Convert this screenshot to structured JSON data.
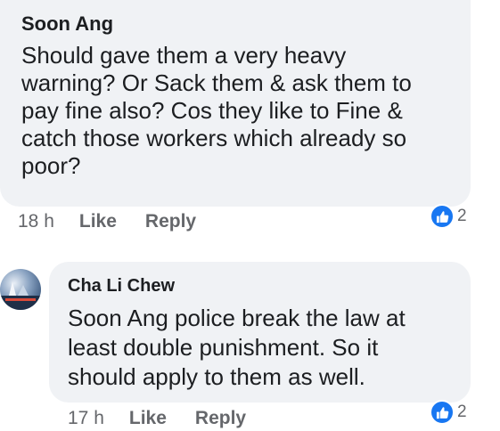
{
  "comments": [
    {
      "author": "Soon Ang",
      "text": "Should gave them a very heavy\nwarning? Or Sack them & ask them to\npay fine also? Cos they like to Fine &\ncatch those workers which already so\npoor?",
      "time": "18 h",
      "like_label": "Like",
      "reply_label": "Reply",
      "reaction_count": "2",
      "reaction_icon": "thumbs-up-icon"
    },
    {
      "author": "Cha Li Chew",
      "text": "Soon Ang  police break the law at\nleast double punishment. So it\nshould apply to them as well.",
      "time": "17 h",
      "like_label": "Like",
      "reply_label": "Reply",
      "reaction_count": "2",
      "reaction_icon": "thumbs-up-icon"
    }
  ],
  "colors": {
    "bubble": "#f0f2f5",
    "text": "#1c1e21",
    "meta": "#65676b",
    "like_blue": "#1877f2"
  }
}
